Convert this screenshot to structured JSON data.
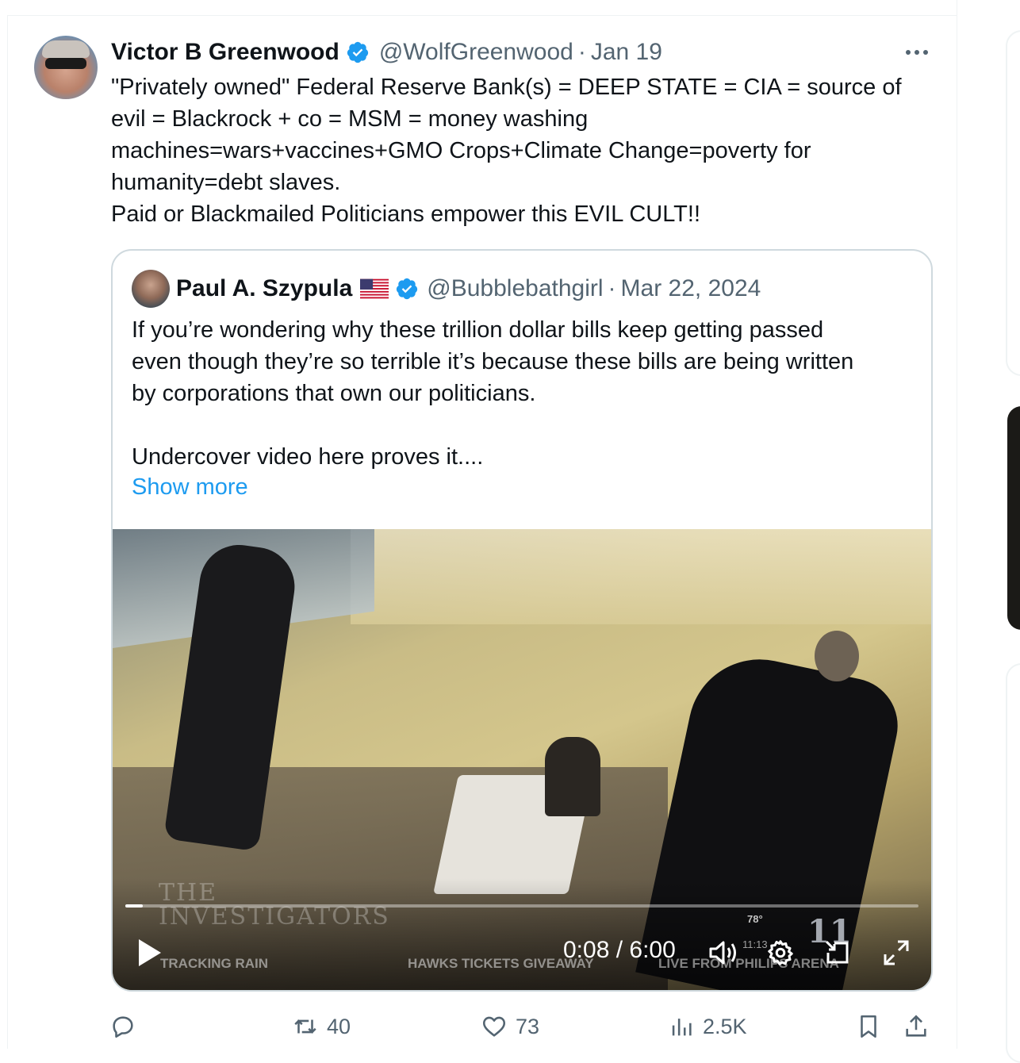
{
  "tweet": {
    "author_name": "Victor B Greenwood",
    "handle": "@WolfGreenwood",
    "separator": "·",
    "date": "Jan 19",
    "text_lines": [
      "\"Privately owned\" Federal Reserve Bank(s) = DEEP STATE = CIA = source of",
      "evil = Blackrock + co = MSM = money washing",
      "machines=wars+vaccines+GMO Crops+Climate Change=poverty for",
      "humanity=debt slaves.",
      "Paid or Blackmailed Politicians empower this EVIL CULT!!"
    ]
  },
  "quote": {
    "author_name": "Paul A. Szypula",
    "handle": "@Bubblebathgirl",
    "separator": "·",
    "date": "Mar 22, 2024",
    "text_lines": [
      "If you’re wondering why these trillion dollar bills keep getting passed",
      "even though they’re so terrible it’s because these bills are being written",
      "by corporations that own our politicians."
    ],
    "text_line_2": "Undercover video here proves it....",
    "show_more": "Show more"
  },
  "video": {
    "time_label": "0:08 / 6:00",
    "progress": 0.022,
    "watermark_top": "THE",
    "watermark_bottom": "INVESTIGATORS",
    "ticker": [
      "TRACKING RAIN",
      "HAWKS TICKETS GIVEAWAY",
      "LIVE FROM PHILIPS ARENA"
    ],
    "temp": "78°",
    "clock": "11:13",
    "logo": "11"
  },
  "actions": {
    "reply_count": "",
    "retweet_count": "40",
    "like_count": "73",
    "views_count": "2.5K"
  },
  "colors": {
    "link": "#1d9bf0",
    "secondary_text": "#536471",
    "verified": "#1d9bf0",
    "border": "#cfd9de"
  }
}
